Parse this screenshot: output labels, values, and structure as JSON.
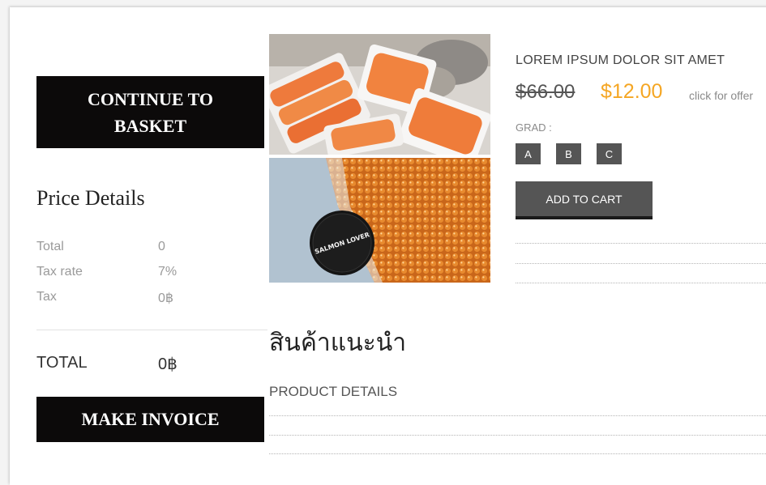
{
  "left": {
    "continue_button": "CONTINUE TO BASKET",
    "price_details_title": "Price Details",
    "rows": [
      {
        "label": "Total",
        "value": "0"
      },
      {
        "label": "Tax rate",
        "value": "7%"
      },
      {
        "label": "Tax",
        "value": "0฿"
      }
    ],
    "total_label": "TOTAL",
    "total_value": "0฿",
    "invoice_button": "MAKE INVOICE"
  },
  "product": {
    "name": "LOREM IPSUM DOLOR SIT AMET",
    "old_price": "$66.00",
    "new_price": "$12.00",
    "offer_link": "click for offer",
    "grade_label": "GRAD :",
    "grades": [
      "A",
      "B",
      "C"
    ],
    "add_to_cart": "ADD TO CART",
    "image_label": "SALMON LOVER"
  },
  "recommend": {
    "title": "สินค้าแนะนำ",
    "details_label": "PRODUCT DETAILS"
  },
  "colors": {
    "button_black": "#0c0a0a",
    "price_orange": "#f5a623",
    "grey_button": "#555555"
  }
}
